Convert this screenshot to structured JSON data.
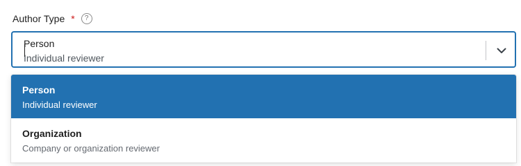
{
  "field": {
    "label": "Author Type",
    "required_mark": "*",
    "help_icon": "?"
  },
  "select": {
    "selected_title": "Person",
    "selected_description": "Individual reviewer"
  },
  "options": [
    {
      "title": "Person",
      "description": "Individual reviewer",
      "highlighted": true
    },
    {
      "title": "Organization",
      "description": "Company or organization reviewer",
      "highlighted": false
    }
  ],
  "colors": {
    "accent": "#2271b1",
    "required": "#cc1818"
  },
  "icons": {
    "help": "question-circle-icon",
    "toggle": "chevron-down-icon"
  }
}
